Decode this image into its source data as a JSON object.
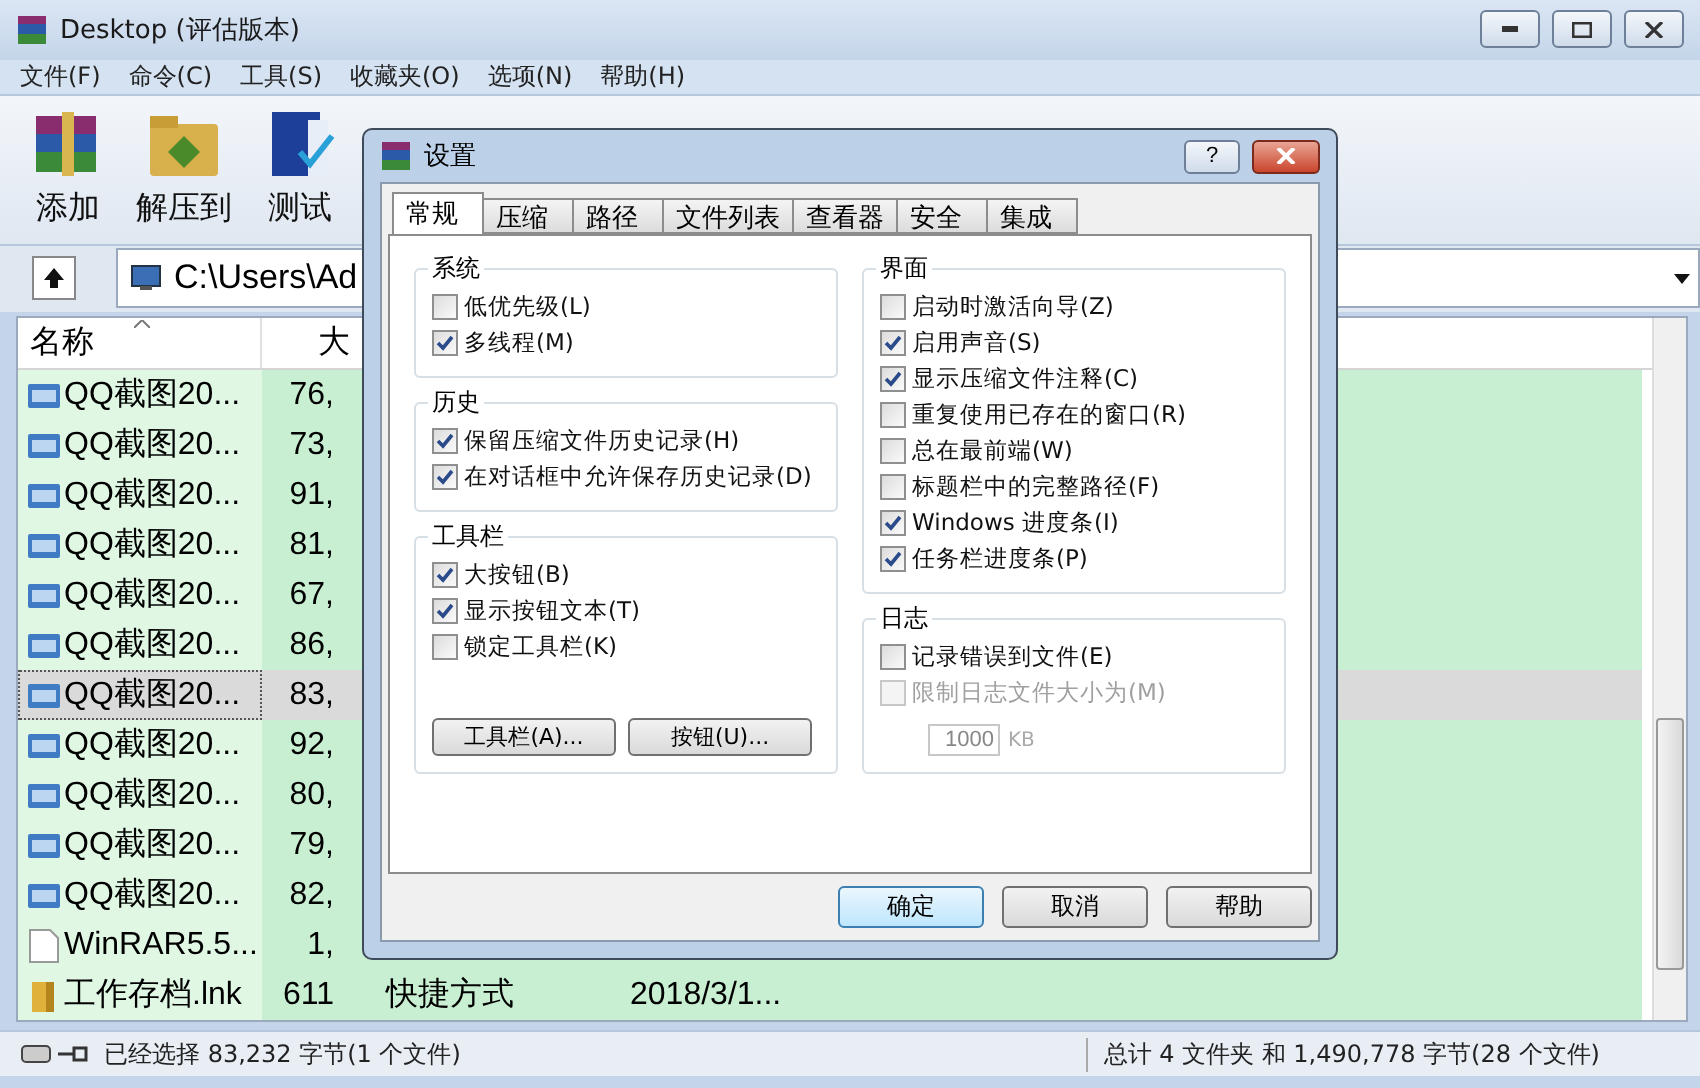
{
  "window": {
    "title": "Desktop (评估版本)"
  },
  "menu": [
    "文件(F)",
    "命令(C)",
    "工具(S)",
    "收藏夹(O)",
    "选项(N)",
    "帮助(H)"
  ],
  "toolbar": [
    {
      "label": "添加",
      "kind": "add"
    },
    {
      "label": "解压到",
      "kind": "extract"
    },
    {
      "label": "测试",
      "kind": "test"
    }
  ],
  "address": {
    "path": "C:\\Users\\Ad"
  },
  "file_list": {
    "columns": [
      "名称",
      "大"
    ],
    "rows": [
      {
        "kind": "jpg",
        "name": "QQ截图20...",
        "size": "76,",
        "selected": false
      },
      {
        "kind": "jpg",
        "name": "QQ截图20...",
        "size": "73,",
        "selected": false
      },
      {
        "kind": "jpg",
        "name": "QQ截图20...",
        "size": "91,",
        "selected": false
      },
      {
        "kind": "jpg",
        "name": "QQ截图20...",
        "size": "81,",
        "selected": false
      },
      {
        "kind": "jpg",
        "name": "QQ截图20...",
        "size": "67,",
        "selected": false
      },
      {
        "kind": "jpg",
        "name": "QQ截图20...",
        "size": "86,",
        "selected": false
      },
      {
        "kind": "jpg",
        "name": "QQ截图20...",
        "size": "83,",
        "selected": true
      },
      {
        "kind": "jpg",
        "name": "QQ截图20...",
        "size": "92,",
        "selected": false
      },
      {
        "kind": "jpg",
        "name": "QQ截图20...",
        "size": "80,",
        "selected": false
      },
      {
        "kind": "jpg",
        "name": "QQ截图20...",
        "size": "79,",
        "selected": false
      },
      {
        "kind": "jpg",
        "name": "QQ截图20...",
        "size": "82,",
        "selected": false
      },
      {
        "kind": "text",
        "name": "WinRAR5.5...",
        "size": "1,",
        "selected": false
      },
      {
        "kind": "folder",
        "name": "工作存档.lnk",
        "size": "611",
        "column_3": "快捷方式",
        "column_4": "2018/3/1...",
        "selected": false
      }
    ]
  },
  "status_bar": {
    "selection": "已经选择 83,232 字节(1 个文件)",
    "total": "总计 4 文件夹 和 1,490,778 字节(28 个文件)"
  },
  "dialog": {
    "title": "设置",
    "help": "?",
    "tabs": [
      {
        "label": "常规",
        "selected": true
      },
      {
        "label": "压缩",
        "selected": false
      },
      {
        "label": "路径",
        "selected": false
      },
      {
        "label": "文件列表",
        "selected": false
      },
      {
        "label": "查看器",
        "selected": false
      },
      {
        "label": "安全",
        "selected": false
      },
      {
        "label": "集成",
        "selected": false
      }
    ],
    "left_groups": [
      {
        "title": "系统",
        "options": [
          {
            "label": "低优先级(L)",
            "checked": false,
            "disabled": false
          },
          {
            "label": "多线程(M)",
            "checked": true,
            "disabled": false
          }
        ]
      },
      {
        "title": "历史",
        "options": [
          {
            "label": "保留压缩文件历史记录(H)",
            "checked": true,
            "disabled": false
          },
          {
            "label": "在对话框中允许保存历史记录(D)",
            "checked": true,
            "disabled": false
          }
        ]
      },
      {
        "title": "工具栏",
        "options": [
          {
            "label": "大按钮(B)",
            "checked": true,
            "disabled": false
          },
          {
            "label": "显示按钮文本(T)",
            "checked": true,
            "disabled": false
          },
          {
            "label": "锁定工具栏(K)",
            "checked": false,
            "disabled": false
          }
        ],
        "buttons": [
          "工具栏(A)...",
          "按钮(U)..."
        ]
      }
    ],
    "right_groups": [
      {
        "title": "界面",
        "options": [
          {
            "label": "启动时激活向导(Z)",
            "checked": false,
            "disabled": false
          },
          {
            "label": "启用声音(S)",
            "checked": true,
            "disabled": false
          },
          {
            "label": "显示压缩文件注释(C)",
            "checked": true,
            "disabled": false
          },
          {
            "label": "重复使用已存在的窗口(R)",
            "checked": false,
            "disabled": false
          },
          {
            "label": "总在最前端(W)",
            "checked": false,
            "disabled": false
          },
          {
            "label": "标题栏中的完整路径(F)",
            "checked": false,
            "disabled": false
          },
          {
            "label": "Windows 进度条(I)",
            "checked": true,
            "disabled": false
          },
          {
            "label": "任务栏进度条(P)",
            "checked": true,
            "disabled": false
          }
        ]
      },
      {
        "title": "日志",
        "options": [
          {
            "label": "记录错误到文件(E)",
            "checked": false,
            "disabled": false
          },
          {
            "label": "限制日志文件大小为(M)",
            "checked": false,
            "disabled": true
          }
        ],
        "size_field": {
          "value": "1000",
          "unit": "KB",
          "disabled": true
        }
      }
    ],
    "buttons": [
      {
        "label": "确定",
        "default": true
      },
      {
        "label": "取消",
        "default": false
      },
      {
        "label": "帮助",
        "default": false
      }
    ]
  }
}
